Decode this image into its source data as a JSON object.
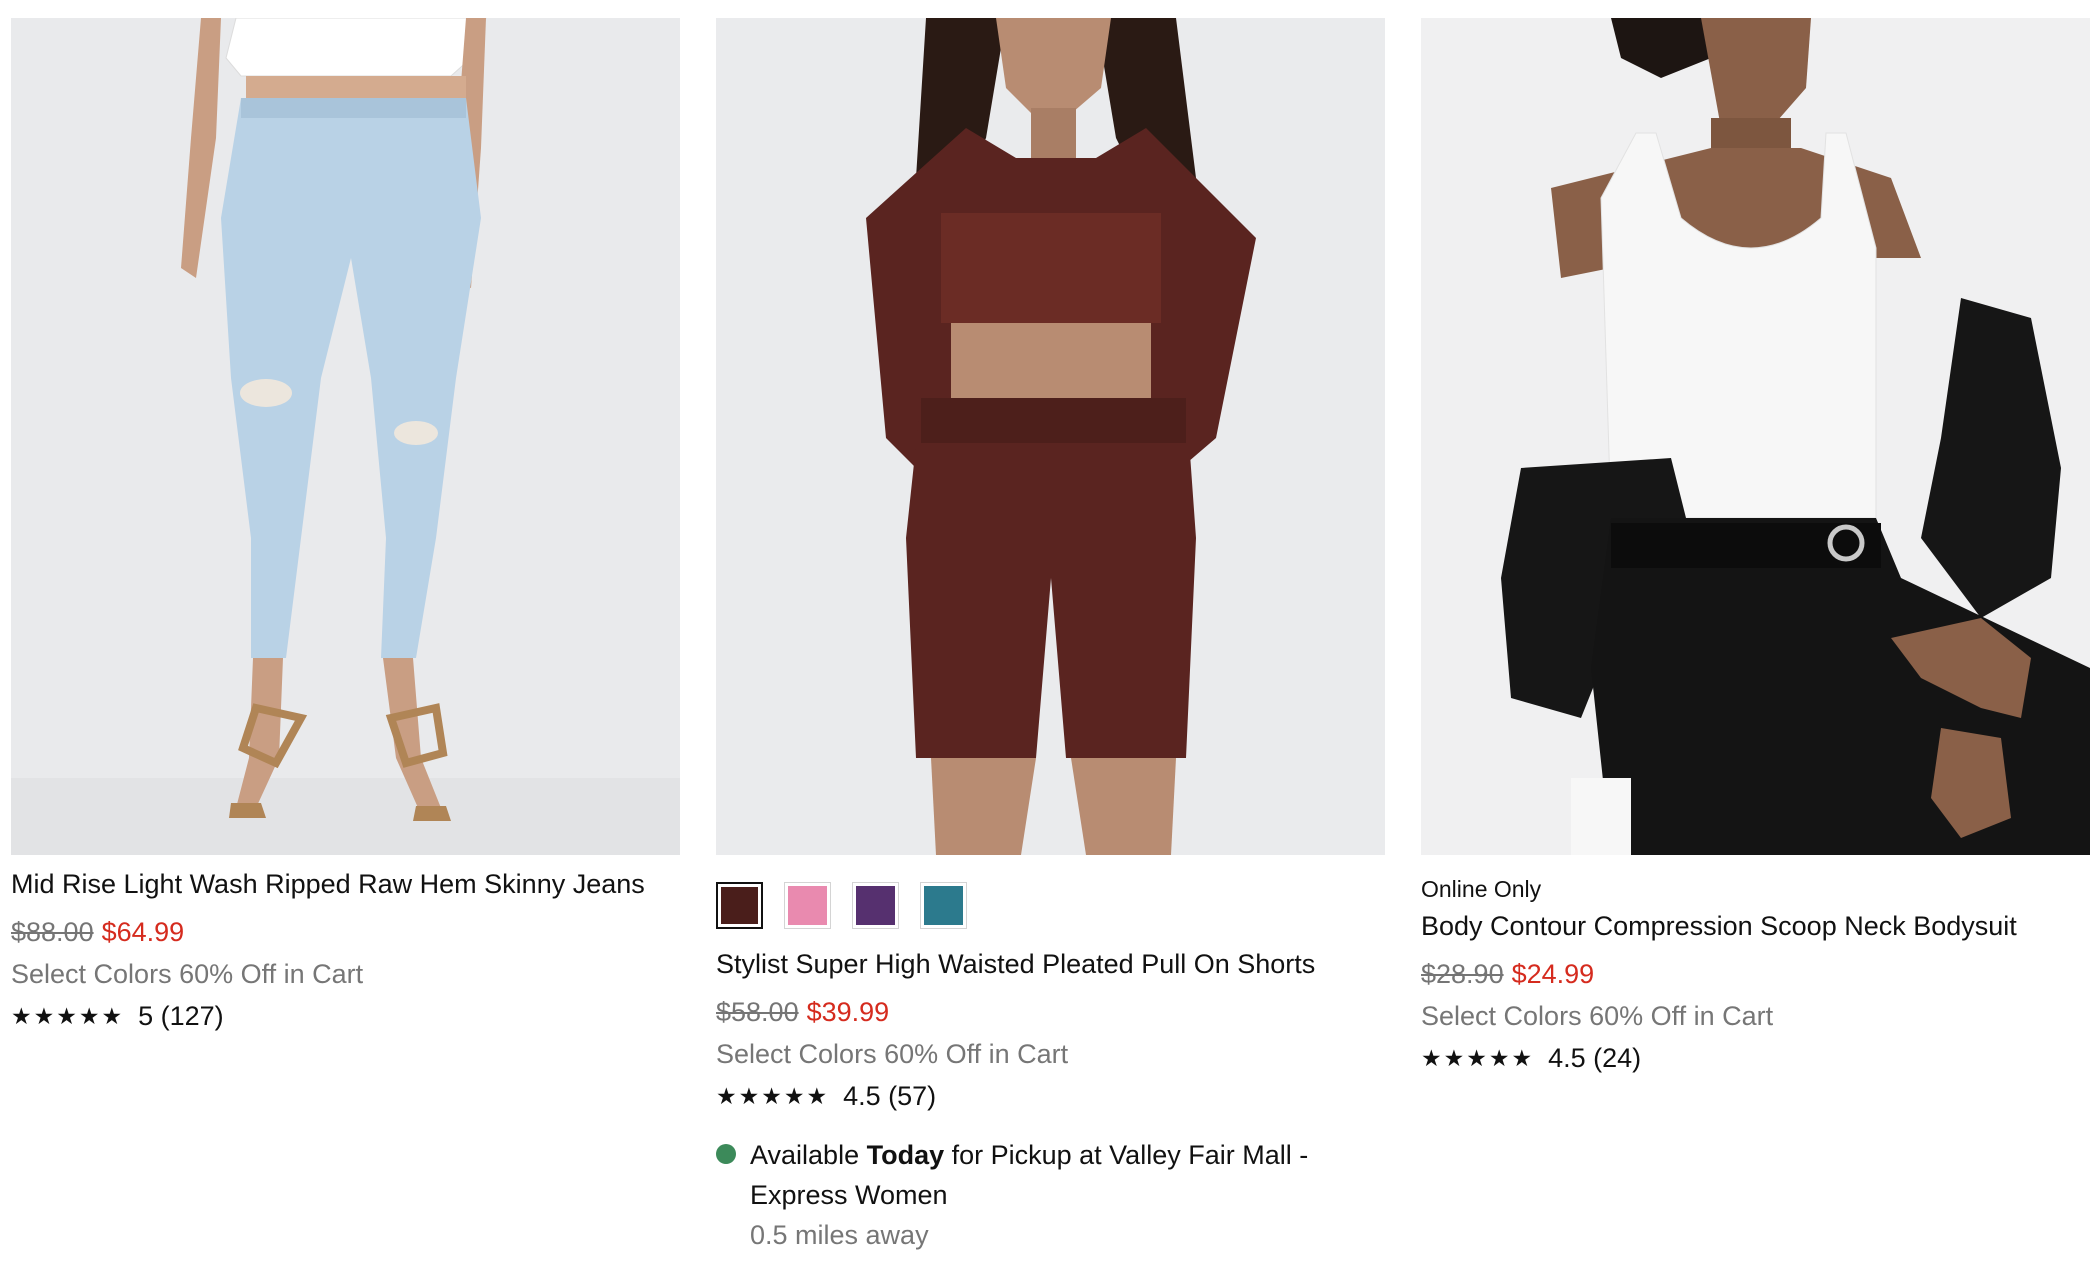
{
  "colors": {
    "sale_price": "#d52b1e",
    "muted_text": "#767676",
    "available_dot": "#3c8a5a"
  },
  "products": [
    {
      "eyebrow": "",
      "title": "Mid Rise Light Wash Ripped Raw Hem Skinny Jeans",
      "original_price": "$88.00",
      "sale_price": "$64.99",
      "promo": "Select Colors 60% Off in Cart",
      "stars": "★★★★★",
      "rating_text": "5 (127)",
      "image_label": "model wearing light wash ripped skinny jeans and tan heeled sandals"
    },
    {
      "swatches": [
        {
          "name": "brown",
          "color": "#4a1e1b",
          "selected": true
        },
        {
          "name": "pink",
          "color": "#e98aaf",
          "selected": false
        },
        {
          "name": "purple",
          "color": "#56306f",
          "selected": false
        },
        {
          "name": "teal",
          "color": "#2c7a8d",
          "selected": false
        }
      ],
      "title": "Stylist Super High Waisted Pleated Pull On Shorts",
      "original_price": "$58.00",
      "sale_price": "$39.99",
      "promo": "Select Colors 60% Off in Cart",
      "stars": "★★★★★",
      "rating_text": "4.5 (57)",
      "pickup": {
        "prefix": "Available ",
        "emphasis": "Today",
        "suffix": " for Pickup at Valley Fair Mall - Express Women",
        "distance": "0.5 miles away"
      },
      "image_label": "model wearing brown tube top, high waisted shorts and draped shirt"
    },
    {
      "eyebrow": "Online Only",
      "title": "Body Contour Compression Scoop Neck Bodysuit",
      "original_price": "$28.90",
      "sale_price": "$24.99",
      "promo": "Select Colors 60% Off in Cart",
      "stars": "★★★★★",
      "rating_text": "4.5 (24)",
      "image_label": "model wearing white scoop neck bodysuit with black shirt and pants"
    }
  ]
}
